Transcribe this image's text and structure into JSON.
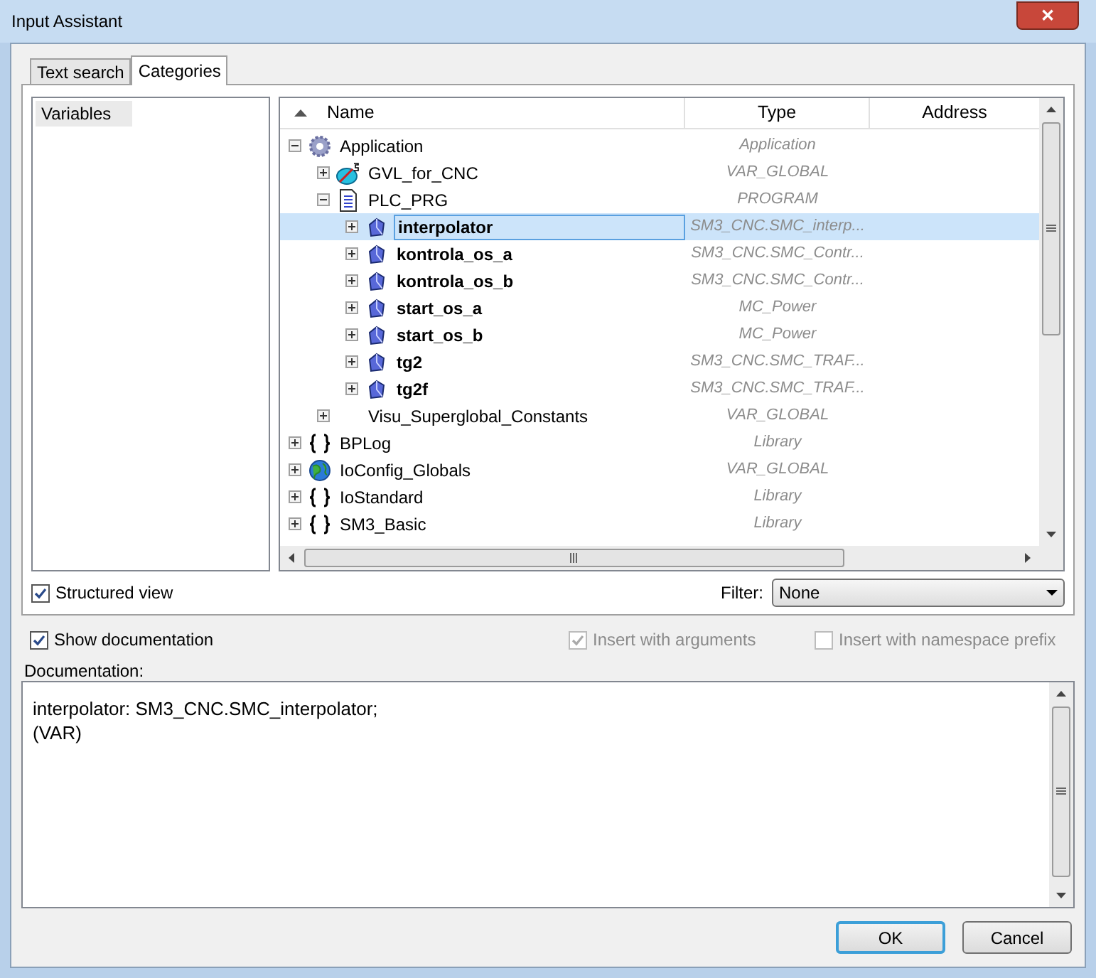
{
  "window": {
    "title": "Input Assistant",
    "close": "✕"
  },
  "tabs": [
    {
      "label": "Text search",
      "selected": false
    },
    {
      "label": "Categories",
      "selected": true
    }
  ],
  "categories": [
    {
      "label": "Variables",
      "selected": true
    }
  ],
  "tree": {
    "columns": [
      "Name",
      "Type",
      "Address"
    ],
    "rows": [
      {
        "name": "Application",
        "type": "Application",
        "kind": "gear",
        "expanded": true,
        "selected": false,
        "children": [
          {
            "name": "GVL_for_CNC",
            "type": "VAR_GLOBAL",
            "kind": "gvl",
            "expanded": false,
            "selected": false
          },
          {
            "name": "PLC_PRG",
            "type": "PROGRAM",
            "kind": "program",
            "expanded": true,
            "selected": false,
            "children": [
              {
                "name": "interpolator",
                "type": "SM3_CNC.SMC_interp...",
                "kind": "variable",
                "expanded": false,
                "selected": true
              },
              {
                "name": "kontrola_os_a",
                "type": "SM3_CNC.SMC_Contr...",
                "kind": "variable",
                "expanded": false,
                "selected": false
              },
              {
                "name": "kontrola_os_b",
                "type": "SM3_CNC.SMC_Contr...",
                "kind": "variable",
                "expanded": false,
                "selected": false
              },
              {
                "name": "start_os_a",
                "type": "MC_Power",
                "kind": "variable",
                "expanded": false,
                "selected": false
              },
              {
                "name": "start_os_b",
                "type": "MC_Power",
                "kind": "variable",
                "expanded": false,
                "selected": false
              },
              {
                "name": "tg2",
                "type": "SM3_CNC.SMC_TRAF...",
                "kind": "variable",
                "expanded": false,
                "selected": false
              },
              {
                "name": "tg2f",
                "type": "SM3_CNC.SMC_TRAF...",
                "kind": "variable",
                "expanded": false,
                "selected": false
              }
            ]
          },
          {
            "name": "Visu_Superglobal_Constants",
            "type": "VAR_GLOBAL",
            "kind": "none",
            "expanded": false,
            "selected": false
          }
        ]
      },
      {
        "name": "BPLog",
        "type": "Library",
        "kind": "library",
        "expanded": false,
        "selected": false
      },
      {
        "name": "IoConfig_Globals",
        "type": "VAR_GLOBAL",
        "kind": "globe",
        "expanded": false,
        "selected": false
      },
      {
        "name": "IoStandard",
        "type": "Library",
        "kind": "library",
        "expanded": false,
        "selected": false
      },
      {
        "name": "SM3_Basic",
        "type": "Library",
        "kind": "library",
        "expanded": false,
        "selected": false
      }
    ]
  },
  "structured_view": {
    "label": "Structured view",
    "checked": true,
    "disabled": false
  },
  "filter": {
    "label": "Filter:",
    "value": "None"
  },
  "show_documentation": {
    "label": "Show documentation",
    "checked": true,
    "disabled": false
  },
  "insert_with_arguments": {
    "label": "Insert with arguments",
    "checked": true,
    "disabled": true
  },
  "insert_with_namespace_prefix": {
    "label": "Insert with namespace prefix",
    "checked": false,
    "disabled": true
  },
  "documentation": {
    "label": "Documentation:",
    "lines": [
      "interpolator: SM3_CNC.SMC_interpolator;",
      "(VAR)"
    ]
  },
  "buttons": [
    {
      "label": "OK",
      "default": true
    },
    {
      "label": "Cancel",
      "default": false
    }
  ]
}
